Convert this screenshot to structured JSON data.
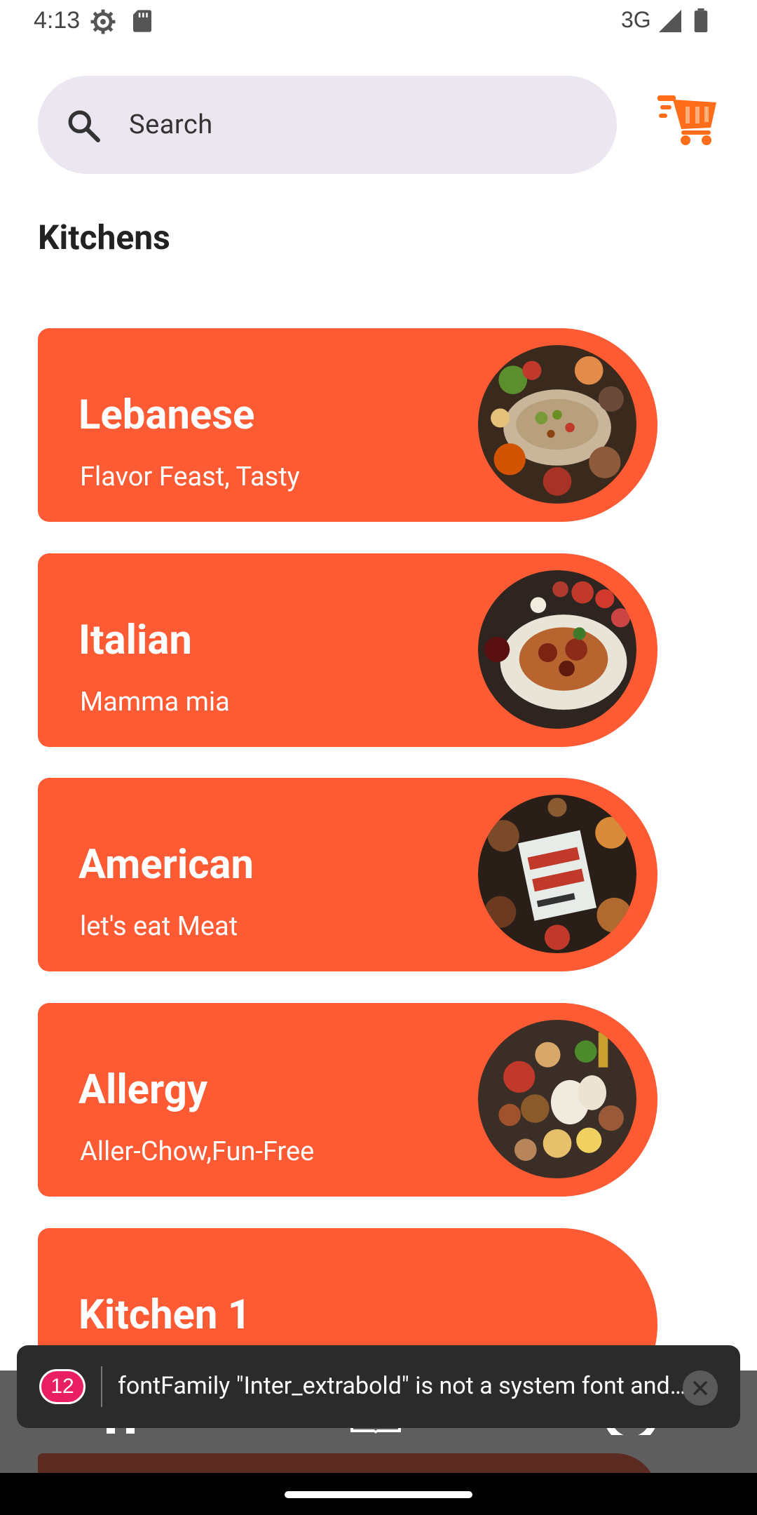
{
  "status_bar": {
    "time": "4:13",
    "network": "3G",
    "icons": [
      "settings-gear-icon",
      "sd-card-icon",
      "signal-icon",
      "battery-icon"
    ]
  },
  "search": {
    "placeholder": "Search",
    "icon": "search-icon"
  },
  "cart": {
    "icon": "shopping-cart-icon",
    "color": "#ff6d1a"
  },
  "section": {
    "title": "Kitchens"
  },
  "kitchens": [
    {
      "title": "Lebanese",
      "subtitle": "Flavor Feast, Tasty",
      "image": "lebanese-food-photo"
    },
    {
      "title": "Italian",
      "subtitle": "Mamma mia",
      "image": "italian-pasta-photo"
    },
    {
      "title": "American",
      "subtitle": "let's eat Meat",
      "image": "american-food-photo"
    },
    {
      "title": "Allergy",
      "subtitle": "Aller-Chow,Fun-Free",
      "image": "allergy-food-photo"
    },
    {
      "title": "Kitchen 1",
      "subtitle": "",
      "image": ""
    }
  ],
  "toast": {
    "count": "12",
    "message": "fontFamily \"Inter_extrabold\" is not a system font and has not been loaded through expo-font."
  },
  "colors": {
    "card": "#fe5a33",
    "search_bg": "#ece6f0",
    "toast_bg": "#2b2b2b",
    "badge": "#e91e63"
  }
}
